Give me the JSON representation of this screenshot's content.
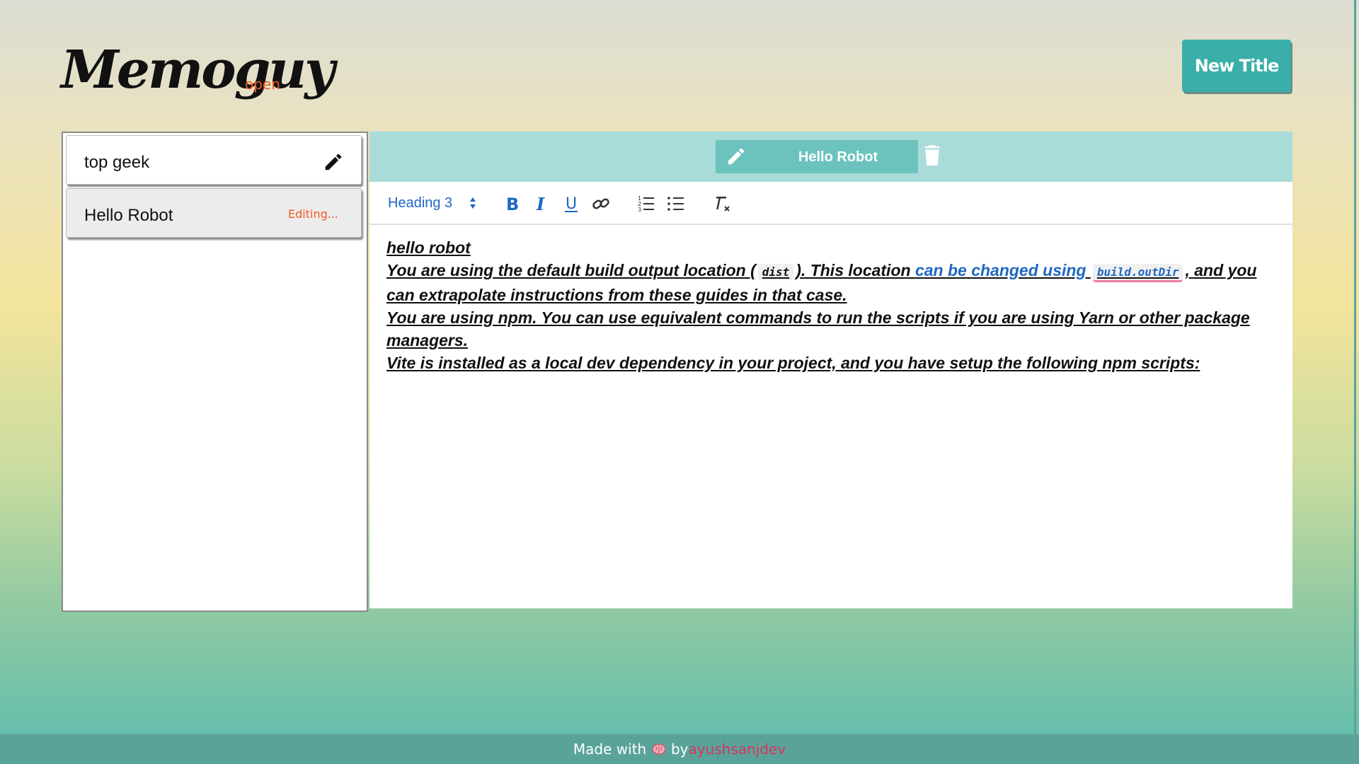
{
  "header": {
    "logo_text": "Memoguy",
    "status": "open",
    "new_title_button": "New Title"
  },
  "sidebar": {
    "notes": [
      {
        "title": "top geek",
        "action_icon": "pencil-icon"
      },
      {
        "title": "Hello Robot",
        "status": "Editing..."
      }
    ]
  },
  "editor": {
    "title": "Hello Robot",
    "title_icon": "pencil-icon",
    "delete_icon": "trash-icon",
    "toolbar": {
      "heading_select": "Heading 3",
      "buttons": [
        "bold-icon",
        "italic-icon",
        "underline-icon",
        "link-icon",
        "ordered-list-icon",
        "bullet-list-icon",
        "clear-format-icon"
      ]
    },
    "content": {
      "line1": "hello robot",
      "p2_before": "You are using the default build output location (",
      "p2_code1": "dist",
      "p2_mid": "). This location ",
      "p2_link_text": "can be changed using ",
      "p2_link_code": "build.outDir",
      "p2_after": ", and you can extrapolate instructions from these guides in that case.",
      "p3": "You are using npm. You can use equivalent commands to run the scripts if you are using Yarn or other package managers.",
      "p4": "Vite is installed as a local dev dependency in your project, and you have setup the following npm scripts:"
    }
  },
  "footer": {
    "made_with": "Made with",
    "heart_icon": "brain-icon",
    "by": "by",
    "author": "ayushsanjdev"
  },
  "colors": {
    "accent": "#3aaea8",
    "status_orange": "#ef5a1f",
    "link_blue": "#1f66c2",
    "footer_author": "#d9355c"
  }
}
